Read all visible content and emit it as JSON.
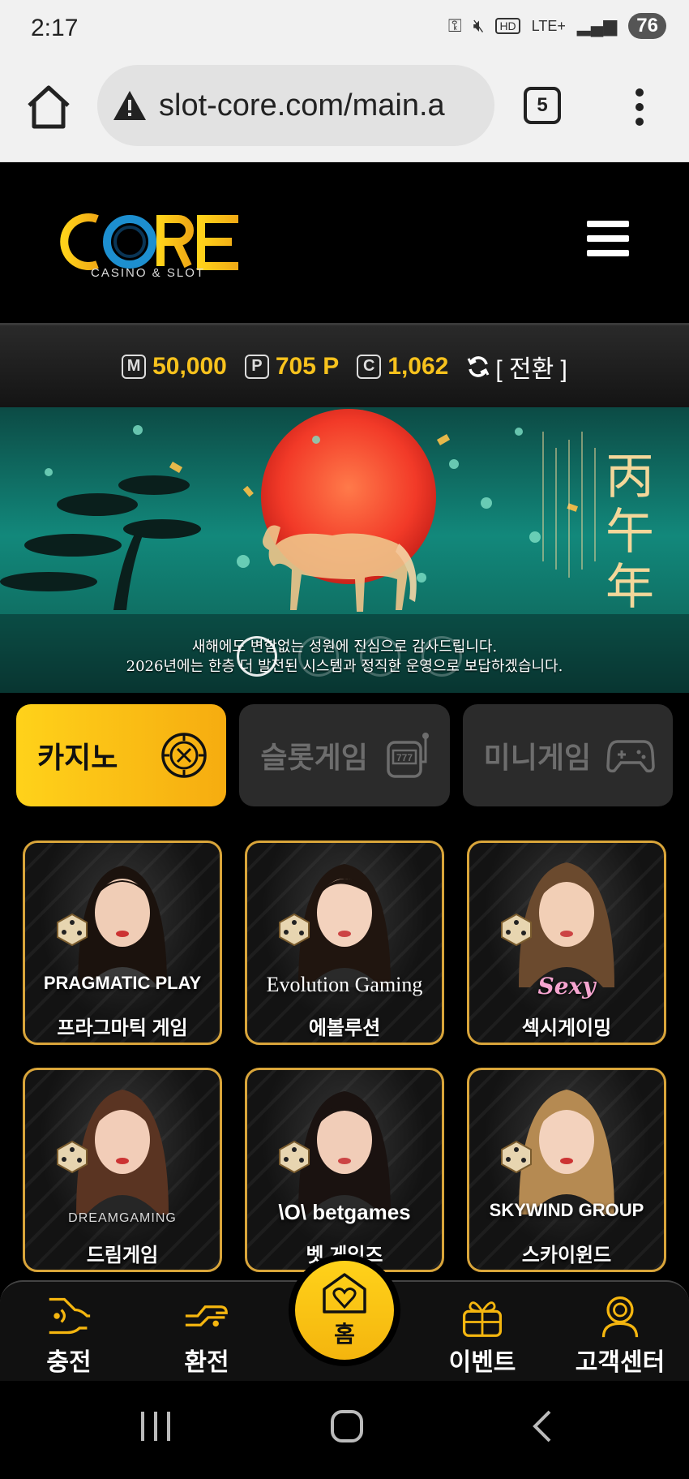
{
  "status_bar": {
    "time": "2:17",
    "network": "LTE+",
    "battery": "76"
  },
  "browser": {
    "url": "slot-core.com/main.a",
    "tab_count": "5"
  },
  "site": {
    "logo_text": "CORE",
    "logo_subtitle": "CASINO & SLOT"
  },
  "balance": {
    "money": {
      "badge": "M",
      "value": "50,000"
    },
    "point": {
      "badge": "P",
      "value": "705 P"
    },
    "casino": {
      "badge": "C",
      "value": "1,062"
    },
    "switch_label": "[ 전환 ]"
  },
  "banner": {
    "calligraphy": [
      "丙",
      "午",
      "年"
    ],
    "caption_line1": "새해에도 변함없는 성원에 진심으로 감사드립니다.",
    "caption_line2": "2026년에는 한층 더 발전된 시스템과 정직한 운영으로 보답하겠습니다.",
    "slide_count": 4,
    "active_slide": 1
  },
  "categories": [
    {
      "label": "카지노",
      "icon": "roulette-icon",
      "active": true
    },
    {
      "label": "슬롯게임",
      "icon": "slot-machine-icon",
      "active": false
    },
    {
      "label": "미니게임",
      "icon": "gamepad-icon",
      "active": false
    }
  ],
  "games": [
    {
      "brand": "PRAGMATIC PLAY",
      "name": "프라그마틱 게임"
    },
    {
      "brand": "Evolution Gaming",
      "name": "에볼루션"
    },
    {
      "brand": "Sexy",
      "name": "섹시게이밍"
    },
    {
      "brand": "DREAMGAMING",
      "name": "드림게임"
    },
    {
      "brand": "\\O\\ betgames",
      "name": "벳 게임즈"
    },
    {
      "brand": "SKYWIND GROUP",
      "name": "스카이윈드"
    }
  ],
  "bottom_nav": {
    "charge": "충전",
    "exchange": "환전",
    "home": "홈",
    "event": "이벤트",
    "support": "고객센터"
  },
  "colors": {
    "accent": "#f7c21d",
    "card_border": "#d9a53a",
    "banner": "#12887b"
  }
}
